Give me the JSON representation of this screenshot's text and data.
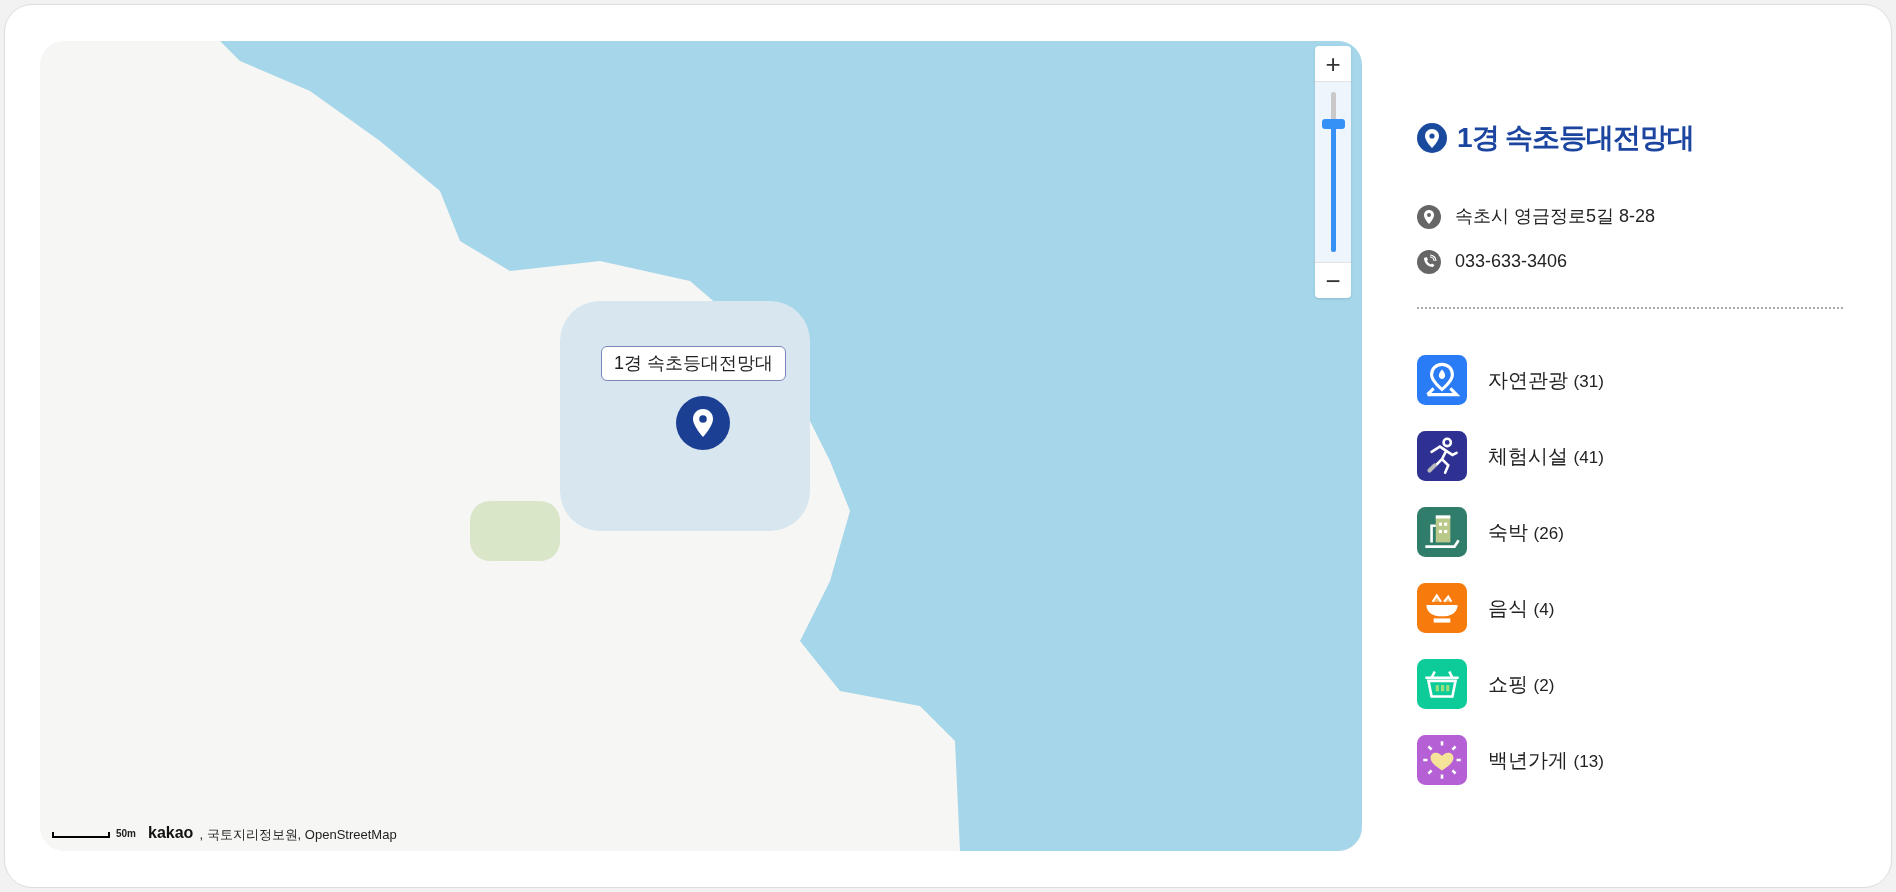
{
  "map": {
    "callout": "1경 속초등대전망대",
    "zoom": {
      "plus": "+",
      "minus": "−",
      "level": 0.83
    },
    "scale": "50m",
    "attribution": {
      "brand": "kakao",
      "sources": ", 국토지리정보원, OpenStreetMap"
    }
  },
  "place": {
    "title": "1경 속초등대전망대",
    "address": "속초시 영금정로5길 8-28",
    "phone": "033-633-3406"
  },
  "categories": [
    {
      "kind": "nature",
      "name": "자연관광",
      "count": "(31)",
      "color": "#2a7cf6"
    },
    {
      "kind": "activity",
      "name": "체험시설",
      "count": "(41)",
      "color": "#2e3192"
    },
    {
      "kind": "lodging",
      "name": "숙박",
      "count": "(26)",
      "color": "#2f7d6a"
    },
    {
      "kind": "food",
      "name": "음식",
      "count": "(4)",
      "color": "#f77a0c"
    },
    {
      "kind": "shopping",
      "name": "쇼핑",
      "count": "(2)",
      "color": "#0ecb9a"
    },
    {
      "kind": "century",
      "name": "백년가게",
      "count": "(13)",
      "color": "#b660d6"
    }
  ]
}
